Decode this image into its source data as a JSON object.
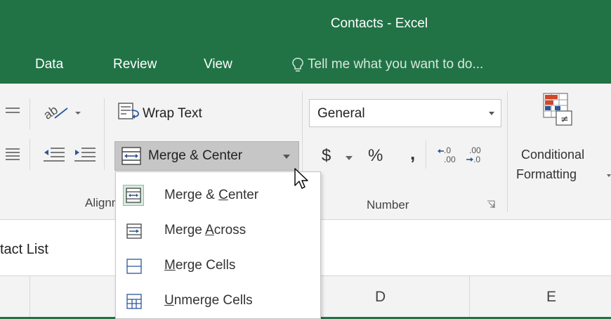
{
  "window": {
    "title": "Contacts - Excel"
  },
  "tabs": [
    {
      "label": "Data"
    },
    {
      "label": "Review"
    },
    {
      "label": "View"
    }
  ],
  "tell_me": {
    "text": "Tell me what you want to do..."
  },
  "alignment": {
    "wrap_text_label": "Wrap Text",
    "merge_center_label": "Merge & Center",
    "group_label": "Alignm"
  },
  "number": {
    "format_value": "General",
    "currency_symbol": "$",
    "percent_symbol": "%",
    "comma_symbol": ",",
    "increase_decimal": "←.0 .00",
    "decrease_decimal": ".00 →.0",
    "group_label": "Number"
  },
  "styles": {
    "conditional_formatting_line1": "Conditional",
    "conditional_formatting_line2": "Formatting"
  },
  "formula_bar": {
    "cell_text": "tact List"
  },
  "columns": [
    "D",
    "E"
  ],
  "merge_menu": {
    "items": [
      {
        "pre": "Merge & ",
        "key": "C",
        "post": "enter"
      },
      {
        "pre": "Merge ",
        "key": "A",
        "post": "cross"
      },
      {
        "pre": "",
        "key": "M",
        "post": "erge Cells"
      },
      {
        "pre": "",
        "key": "U",
        "post": "nmerge Cells"
      }
    ]
  },
  "colors": {
    "brand_green": "#217346",
    "ribbon_bg": "#f3f3f3",
    "hover_bg": "#c6c6c6",
    "icon_blue": "#2b579a"
  }
}
